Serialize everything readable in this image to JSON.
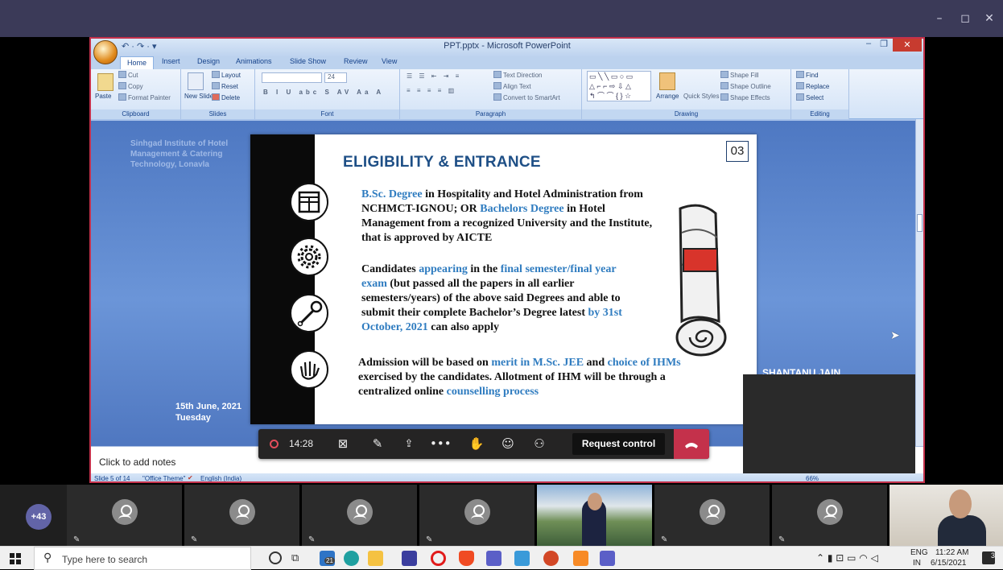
{
  "teams": {
    "window_controls": [
      "–",
      "◻",
      "✕"
    ]
  },
  "ppt": {
    "title": "PPT.pptx - Microsoft PowerPoint",
    "qat": "↶ · ↷ · ▾",
    "tabs": [
      "Home",
      "Insert",
      "Design",
      "Animations",
      "Slide Show",
      "Review",
      "View"
    ],
    "ribbon": {
      "clipboard": {
        "paste": "Paste",
        "cut": "Cut",
        "copy": "Copy",
        "format_painter": "Format Painter",
        "label": "Clipboard"
      },
      "slides": {
        "new_slide": "New Slide",
        "layout": "Layout",
        "reset": "Reset",
        "delete": "Delete",
        "label": "Slides"
      },
      "font": {
        "size": "24",
        "label": "Font"
      },
      "paragraph": {
        "text_direction": "Text Direction",
        "align_text": "Align Text",
        "convert": "Convert to SmartArt",
        "label": "Paragraph"
      },
      "drawing": {
        "arrange": "Arrange",
        "quick_styles": "Quick Styles",
        "shape_fill": "Shape Fill",
        "shape_outline": "Shape Outline",
        "shape_effects": "Shape Effects",
        "label": "Drawing"
      },
      "editing": {
        "find": "Find",
        "replace": "Replace",
        "select": "Select",
        "label": "Editing"
      }
    },
    "editor_slide": {
      "institute": "Sinhgad Institute of Hotel Management & Catering Technology, Lonavla",
      "date": "15th June, 2021",
      "day": "Tuesday",
      "presenter": "SHANTANU JAIN"
    },
    "notes_placeholder": "Click to add notes",
    "status": {
      "slide": "Slide 5 of 14",
      "theme": "\"Office Theme\"",
      "language": "English (India)",
      "zoom": "66%"
    }
  },
  "shared_slide": {
    "heading": "ELIGIBILITY & ENTRANCE",
    "number": "03",
    "para1": [
      {
        "t": "B.Sc. Degree",
        "hl": true
      },
      {
        "t": " in Hospitality and Hotel Administration from NCHMCT-IGNOU; OR ",
        "hl": false
      },
      {
        "t": "Bachelors Degree",
        "hl": true
      },
      {
        "t": " in Hotel Management from a recognized University and the Institute, that is approved by AICTE",
        "hl": false
      }
    ],
    "para2": [
      {
        "t": "Candidates ",
        "hl": false
      },
      {
        "t": "appearing",
        "hl": true
      },
      {
        "t": " in the ",
        "hl": false
      },
      {
        "t": "final semester/final year exam",
        "hl": true
      },
      {
        "t": " (but passed all the papers in all earlier semesters/years) of the above said Degrees and able to submit their complete Bachelor’s Degree latest ",
        "hl": false
      },
      {
        "t": "by 31st October, 2021",
        "hl": true
      },
      {
        "t": " can also apply",
        "hl": false
      }
    ],
    "para3": [
      {
        "t": "Admission will be based on ",
        "hl": false
      },
      {
        "t": "merit in M.Sc. JEE",
        "hl": true
      },
      {
        "t": " and ",
        "hl": false
      },
      {
        "t": "choice of IHMs",
        "hl": true
      },
      {
        "t": " exercised by the candidates. Allotment of IHM will be through a centralized online ",
        "hl": false
      },
      {
        "t": "counselling process",
        "hl": true
      }
    ]
  },
  "controls": {
    "recording_time": "14:28",
    "request_control": "Request control"
  },
  "participants": {
    "overflow_count": "+43"
  },
  "taskbar": {
    "search_placeholder": "Type here to search",
    "lang": "ENG",
    "region": "IN",
    "time": "11:22 AM",
    "date": "6/15/2021",
    "notification_count": "3",
    "store_badge": "21"
  }
}
